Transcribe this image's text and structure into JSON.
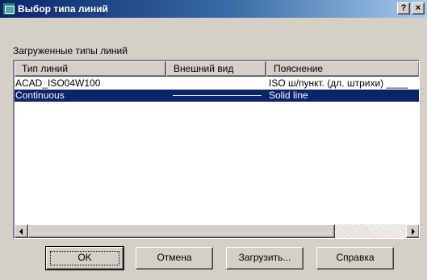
{
  "window": {
    "title": "Выбор типа линий",
    "help_glyph": "?",
    "close_glyph": "×",
    "app_icon": "acad-linetype-icon"
  },
  "group": {
    "label": "Загруженные типы линий"
  },
  "table": {
    "columns": [
      "Тип линий",
      "Внешний вид",
      "Пояснение"
    ],
    "rows": [
      {
        "name": "ACAD_ISO04W100",
        "appearance": "long-dash-dot",
        "description": "ISO ш/пункт. (дл. штрихи) ____",
        "selected": false
      },
      {
        "name": "Continuous",
        "appearance": "solid",
        "description": "Solid line",
        "selected": true
      }
    ]
  },
  "buttons": {
    "ok": "OK",
    "cancel": "Отмена",
    "load": "Загрузить...",
    "help": "Справка"
  },
  "colors": {
    "title_start": "#0a246a",
    "title_end": "#a6caf0",
    "selection": "#0a246a",
    "face": "#d4d0c8"
  }
}
